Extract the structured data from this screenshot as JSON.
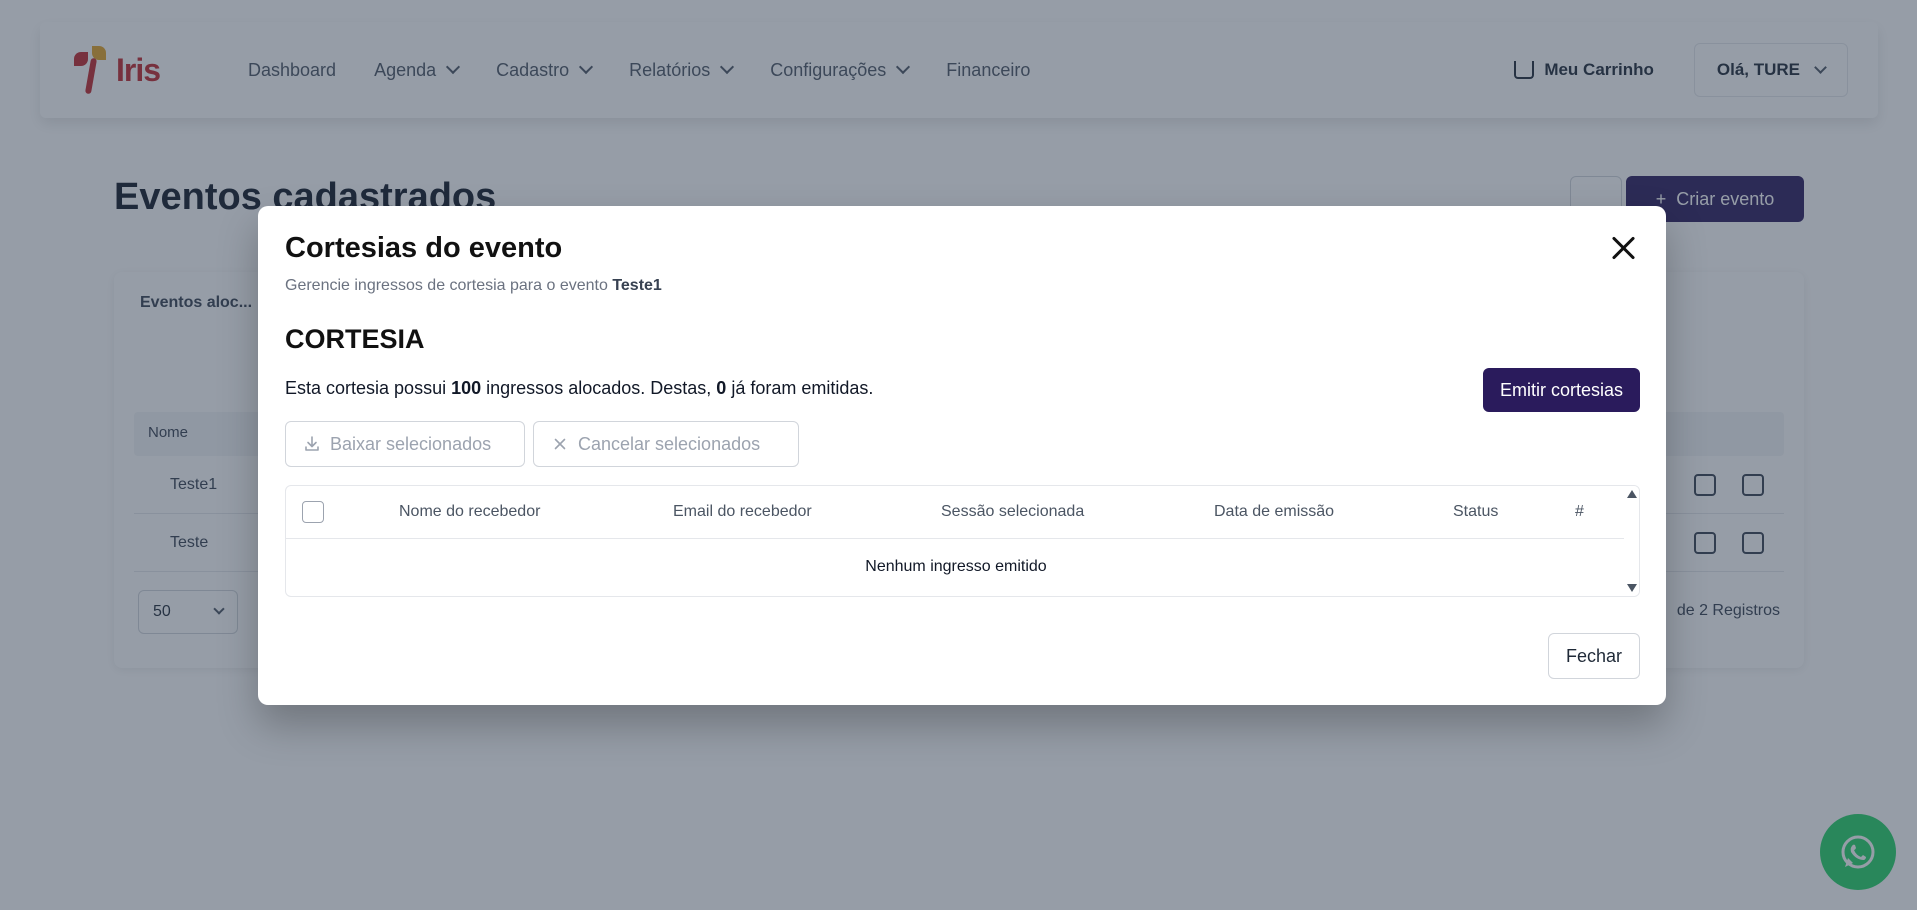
{
  "navbar": {
    "logo_text": "Iris",
    "items": [
      {
        "label": "Dashboard",
        "has_dropdown": false
      },
      {
        "label": "Agenda",
        "has_dropdown": true
      },
      {
        "label": "Cadastro",
        "has_dropdown": true
      },
      {
        "label": "Relatórios",
        "has_dropdown": true
      },
      {
        "label": "Configurações",
        "has_dropdown": true
      },
      {
        "label": "Financeiro",
        "has_dropdown": false
      }
    ],
    "cart_label": "Meu Carrinho",
    "user_label": "Olá, TURE"
  },
  "page": {
    "title": "Eventos cadastrados",
    "create_button_label": "Criar evento",
    "tab_label": "Eventos aloc...",
    "table_header_name": "Nome",
    "rows": [
      {
        "name": "Teste1"
      },
      {
        "name": "Teste"
      }
    ],
    "page_size": "50",
    "total_label": "de 2 Registros"
  },
  "modal": {
    "title": "Cortesias do evento",
    "subtitle_prefix": "Gerencie ingressos de cortesia para o evento",
    "event_name": "Teste1",
    "section_title": "CORTESIA",
    "info_prefix": "Esta cortesia possui",
    "allocated_count": "100",
    "info_middle": "ingressos alocados. Destas,",
    "issued_count": "0",
    "info_suffix": "já foram emitidas.",
    "emit_button": "Emitir cortesias",
    "download_button": "Baixar selecionados",
    "cancel_button": "Cancelar selecionados",
    "columns": [
      "Nome do recebedor",
      "Email do recebedor",
      "Sessão selecionada",
      "Data de emissão",
      "Status",
      "#"
    ],
    "empty_message": "Nenhum ingresso emitido",
    "close_button": "Fechar"
  },
  "colors": {
    "primary": "#2a1b5c",
    "brand_red": "#c0262d",
    "whatsapp": "#25d366",
    "overlay": "rgba(45,60,80,0.5)"
  }
}
